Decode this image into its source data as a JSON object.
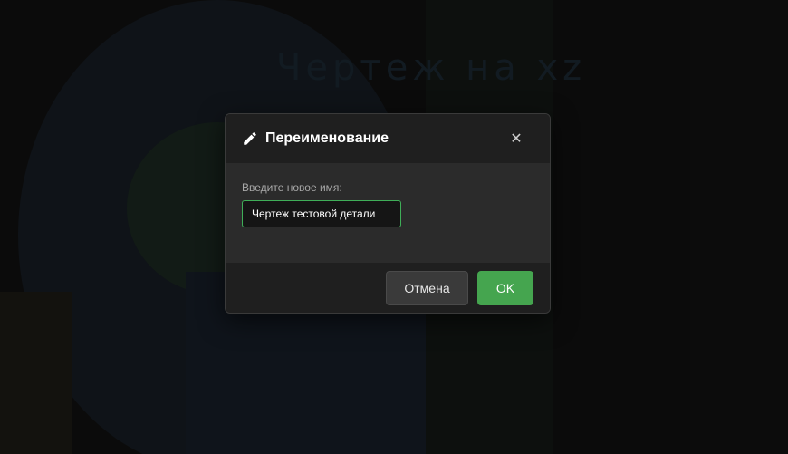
{
  "background": {
    "title_text": "Чертеж на xz"
  },
  "dialog": {
    "title": "Переименование",
    "title_icon": "pencil-icon",
    "close_icon": "close-icon",
    "close_glyph": "✕",
    "field_label": "Введите новое имя:",
    "input_value": "Чертеж тестовой детали",
    "cancel_label": "Отмена",
    "ok_label": "OK"
  },
  "colors": {
    "accent": "#45a54f",
    "input_border": "#3fae58",
    "dialog_bg": "#1f1f1f",
    "body_bg": "#2b2b2b"
  }
}
